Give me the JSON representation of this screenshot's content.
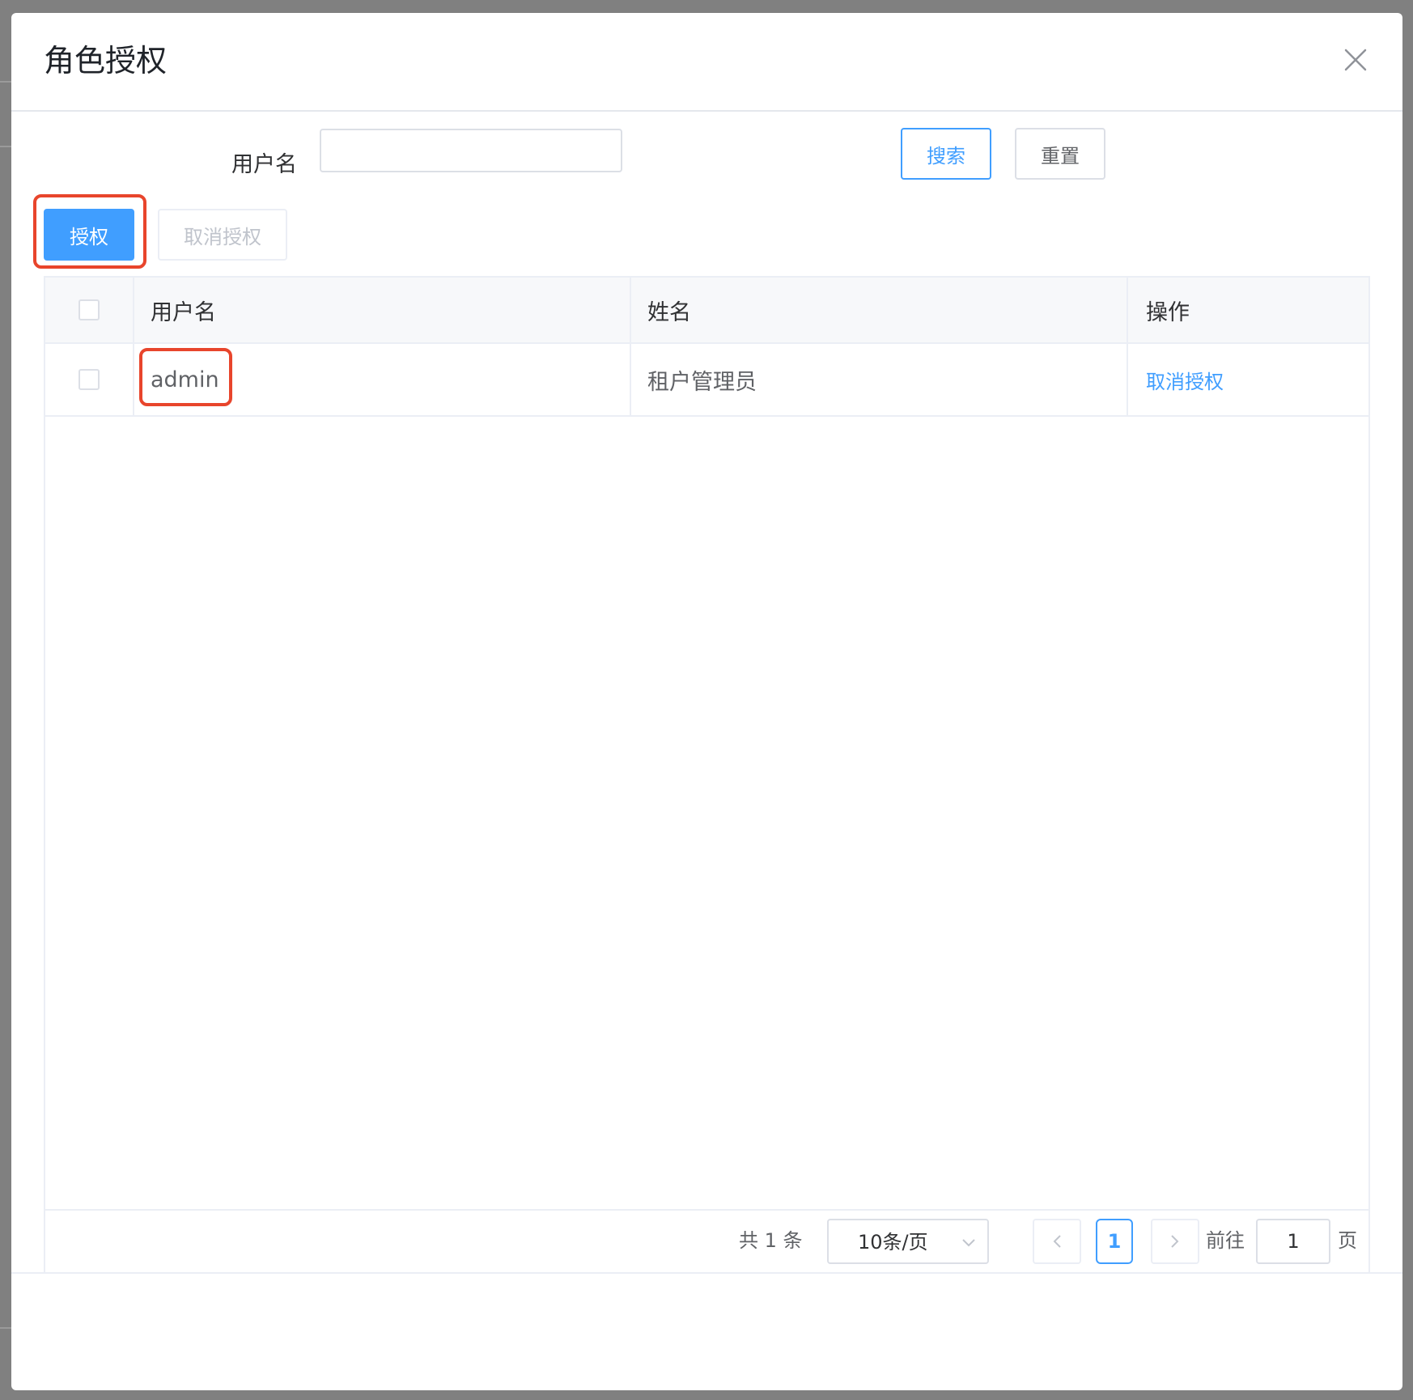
{
  "dialog": {
    "title": "角色授权"
  },
  "search_form": {
    "username_label": "用户名",
    "username_value": "",
    "username_placeholder": "",
    "search_label": "搜索",
    "reset_label": "重置"
  },
  "toolbar": {
    "grant_label": "授权",
    "revoke_label": "取消授权"
  },
  "table": {
    "columns": [
      "用户名",
      "姓名",
      "操作"
    ],
    "rows": [
      {
        "username": "admin",
        "name": "租户管理员",
        "action": "取消授权"
      }
    ]
  },
  "pagination": {
    "total_text": "共 1 条",
    "page_size": "10条/页",
    "current_page": "1",
    "goto_label": "前往",
    "jump_value": "1",
    "page_unit": "页"
  },
  "icons": {
    "close": "close-icon",
    "prev": "chevron-left-icon",
    "next": "chevron-right-icon",
    "dropdown": "chevron-down-icon"
  },
  "colors": {
    "primary": "#409eff",
    "highlight": "#e8452c",
    "backdrop": "#808080"
  }
}
